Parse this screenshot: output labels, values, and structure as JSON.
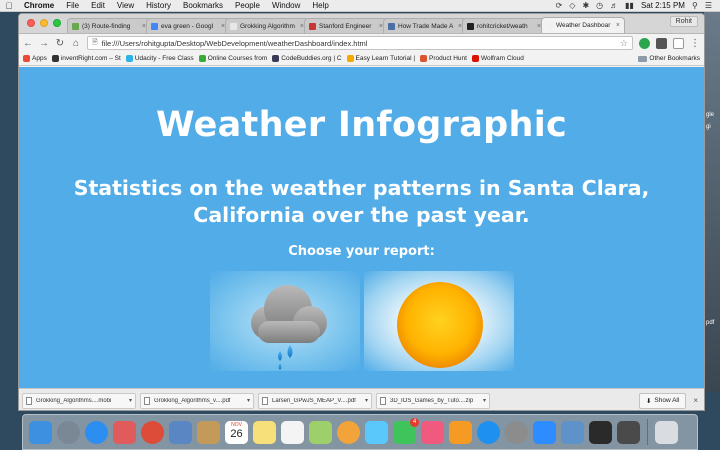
{
  "menubar": {
    "apple": "",
    "items": [
      "Chrome",
      "File",
      "Edit",
      "View",
      "History",
      "Bookmarks",
      "People",
      "Window",
      "Help"
    ],
    "datetime": "Sat 2:15 PM"
  },
  "desktop": {
    "right_fragments": [
      "gle",
      "gi",
      "pdf"
    ]
  },
  "browser": {
    "tabs": [
      {
        "label": "(3) Route-finding",
        "icon_color": "#6aa84f"
      },
      {
        "label": "eva green - Googl",
        "icon_color": "#4285f4"
      },
      {
        "label": "Grokking Algorithm",
        "icon_color": "#e8e8e8"
      },
      {
        "label": "Stanford Engineer",
        "icon_color": "#cc3333"
      },
      {
        "label": "How Trade Made A",
        "icon_color": "#4a6fa5"
      },
      {
        "label": "rohitcricket/weath",
        "icon_color": "#222222"
      },
      {
        "label": "Weather Dashboar",
        "icon_color": "#f0f0f0"
      }
    ],
    "profile": "Rohit",
    "url": "file:///Users/rohitgupta/Desktop/WebDevelopment/weatherDashboard/index.html",
    "bookmarks": [
      {
        "label": "Apps",
        "icon_color": "#e94b35"
      },
      {
        "label": "inventRight.com – St",
        "icon_color": "#333333"
      },
      {
        "label": "Udacity - Free Class",
        "icon_color": "#2fb3e7"
      },
      {
        "label": "Online Courses from",
        "icon_color": "#3aaa35"
      },
      {
        "label": "CodeBuddies.org | C",
        "icon_color": "#3a3a55"
      },
      {
        "label": "Easy Learn Tutorial |",
        "icon_color": "#f2a900"
      },
      {
        "label": "Product Hunt",
        "icon_color": "#da552f"
      },
      {
        "label": "Wolfram Cloud",
        "icon_color": "#dd1100"
      }
    ],
    "other_bookmarks": "Other Bookmarks"
  },
  "page": {
    "title": "Weather Infographic",
    "subtitle": "Statistics on the weather patterns in Santa Clara, California over the past year.",
    "choose_label": "Choose your report:",
    "background": "#51ace7"
  },
  "downloads": {
    "items": [
      "Grokking_Algorithms....mobi",
      "Grokking_Algorithms_v....pdf",
      "Larsen_GPwJS_MEAP_V....pdf",
      "3D_IOS_Games_by_Tuto....zip"
    ],
    "show_all": "Show All"
  },
  "dock": {
    "apps": [
      {
        "name": "finder",
        "color": "#3d8fe0"
      },
      {
        "name": "launchpad",
        "color": "#7a8794"
      },
      {
        "name": "safari",
        "color": "#2b8ef0"
      },
      {
        "name": "app-grid",
        "color": "#e05b5b"
      },
      {
        "name": "chrome",
        "color": "#dd4b39"
      },
      {
        "name": "preview",
        "color": "#5b86c4"
      },
      {
        "name": "notebook",
        "color": "#c49a5a"
      },
      {
        "name": "calendar",
        "color": "#ffffff"
      },
      {
        "name": "notes",
        "color": "#f7e07a"
      },
      {
        "name": "reminders",
        "color": "#f4f4f4"
      },
      {
        "name": "stickies",
        "color": "#9dd06a"
      },
      {
        "name": "photos",
        "color": "#f2a33a"
      },
      {
        "name": "messages",
        "color": "#5ac8fa"
      },
      {
        "name": "facetime",
        "color": "#3fc35b"
      },
      {
        "name": "itunes",
        "color": "#f05a7e"
      },
      {
        "name": "ibooks",
        "color": "#f59a23"
      },
      {
        "name": "app-store",
        "color": "#1e90f0"
      },
      {
        "name": "system-preferences",
        "color": "#8c8c8c"
      },
      {
        "name": "zoom",
        "color": "#2d8cff"
      },
      {
        "name": "image-viewer",
        "color": "#5d93c9"
      },
      {
        "name": "terminal",
        "color": "#2a2a2a"
      },
      {
        "name": "sublime-text",
        "color": "#4a4a4a"
      },
      {
        "name": "trash",
        "color": "#d9dde1"
      }
    ],
    "calendar_day": "26",
    "calendar_month": "NOV",
    "facetime_badge": "4"
  }
}
